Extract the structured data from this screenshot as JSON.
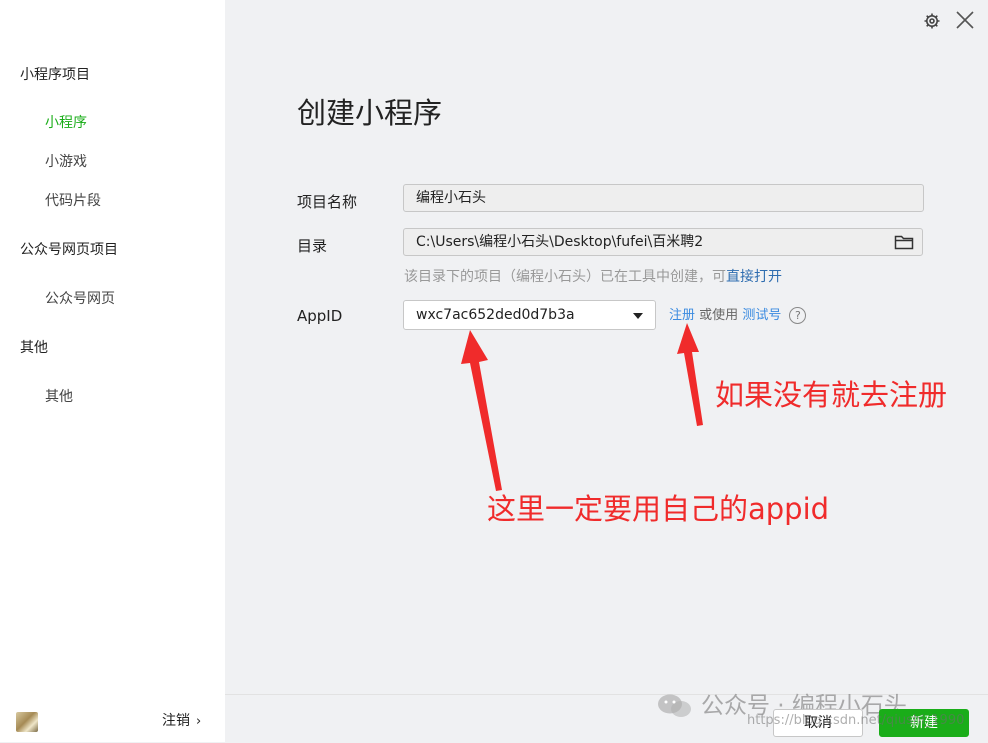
{
  "sidebar": {
    "groups": [
      {
        "title": "小程序项目",
        "items": [
          {
            "label": "小程序",
            "active": true
          },
          {
            "label": "小游戏"
          },
          {
            "label": "代码片段"
          }
        ]
      },
      {
        "title": "公众号网页项目",
        "items": [
          {
            "label": "公众号网页"
          }
        ]
      },
      {
        "title": "其他",
        "items": [
          {
            "label": "其他"
          }
        ]
      }
    ],
    "logout_label": "注销",
    "logout_chevron": "›"
  },
  "header": {
    "title": "创建小程序"
  },
  "form": {
    "name_label": "项目名称",
    "name_value": "编程小石头",
    "dir_label": "目录",
    "dir_value": "C:\\Users\\编程小石头\\Desktop\\fufei\\百米聘2",
    "dir_hint_prefix": "该目录下的项目（编程小石头）已在工具中创建，可",
    "dir_hint_link": "直接打开",
    "appid_label": "AppID",
    "appid_value": "wxc7ac652ded0d7b3a",
    "register_link": "注册",
    "or_use_text": "或使用",
    "test_account_link": "测试号",
    "help_glyph": "?"
  },
  "annotations": {
    "register_note": "如果没有就去注册",
    "appid_note": "这里一定要用自己的appid",
    "color": "#f02b2b"
  },
  "watermark": {
    "text": "公众号 · 编程小石头",
    "url": "https://blog.csdn.net/qiushi_1990"
  },
  "footer": {
    "cancel_label": "取消",
    "create_label": "新建"
  },
  "colors": {
    "accent": "#1aad19",
    "link": "#3b8be0",
    "annotation": "#f02b2b"
  },
  "icons": [
    "gear-icon",
    "close-icon",
    "folder-icon",
    "caret-down-icon",
    "help-icon",
    "wechat-icon",
    "chevron-right-icon"
  ]
}
